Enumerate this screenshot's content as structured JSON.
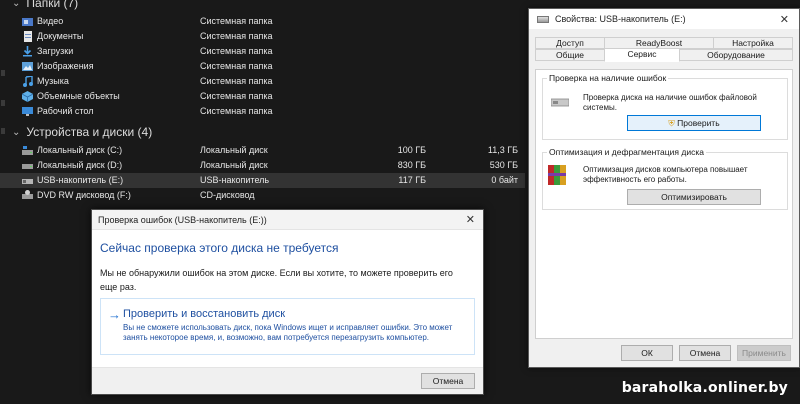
{
  "explorer": {
    "folders_header": "Папки (7)",
    "folders": [
      {
        "name": "Видео",
        "type": "Системная папка",
        "icon": "video-folder-icon"
      },
      {
        "name": "Документы",
        "type": "Системная папка",
        "icon": "documents-folder-icon"
      },
      {
        "name": "Загрузки",
        "type": "Системная папка",
        "icon": "downloads-folder-icon"
      },
      {
        "name": "Изображения",
        "type": "Системная папка",
        "icon": "pictures-folder-icon"
      },
      {
        "name": "Музыка",
        "type": "Системная папка",
        "icon": "music-folder-icon"
      },
      {
        "name": "Объемные объекты",
        "type": "Системная папка",
        "icon": "3d-objects-folder-icon"
      },
      {
        "name": "Рабочий стол",
        "type": "Системная папка",
        "icon": "desktop-folder-icon"
      }
    ],
    "drives_header": "Устройства и диски (4)",
    "drives": [
      {
        "name": "Локальный диск (C:)",
        "type": "Локальный диск",
        "total": "100 ГБ",
        "free": "11,3 ГБ",
        "icon": "system-drive-icon"
      },
      {
        "name": "Локальный диск (D:)",
        "type": "Локальный диск",
        "total": "830 ГБ",
        "free": "530 ГБ",
        "icon": "hard-drive-icon"
      },
      {
        "name": "USB-накопитель (E:)",
        "type": "USB-накопитель",
        "total": "117 ГБ",
        "free": "0 байт",
        "icon": "usb-drive-icon"
      },
      {
        "name": "DVD RW дисковод (F:)",
        "type": "CD-дисковод",
        "total": "",
        "free": "",
        "icon": "dvd-drive-icon"
      }
    ]
  },
  "properties": {
    "title": "Свойства: USB-накопитель (E:)",
    "tabs_row1": [
      "Доступ",
      "ReadyBoost",
      "Настройка"
    ],
    "tabs_row2": [
      "Общие",
      "Сервис",
      "Оборудование"
    ],
    "active_tab": "Сервис",
    "check_group": {
      "title": "Проверка на наличие ошибок",
      "text": "Проверка диска на наличие ошибок файловой системы.",
      "button": "Проверить"
    },
    "optimize_group": {
      "title": "Оптимизация и дефрагментация диска",
      "text": "Оптимизация дисков компьютера повышает эффективность его работы.",
      "button": "Оптимизировать"
    },
    "ok": "ОК",
    "cancel": "Отмена",
    "apply": "Применить"
  },
  "error_check": {
    "title": "Проверка ошибок (USB-накопитель (E:))",
    "heading": "Сейчас проверка этого диска не требуется",
    "message": "Мы не обнаружили ошибок на этом диске. Если вы хотите, то можете проверить его еще раз.",
    "command_title": "Проверить и восстановить диск",
    "command_desc": "Вы не сможете использовать диск, пока Windows ищет и исправляет ошибки. Это может занять некоторое время, и, возможно, вам потребуется перезагрузить компьютер.",
    "cancel": "Отмена"
  },
  "watermark": "baraholka.onliner.by",
  "colors": {
    "explorer_bg": "#191919",
    "selection": "#333333",
    "link_blue": "#1e4fa0",
    "focus_blue": "#0078d7"
  }
}
